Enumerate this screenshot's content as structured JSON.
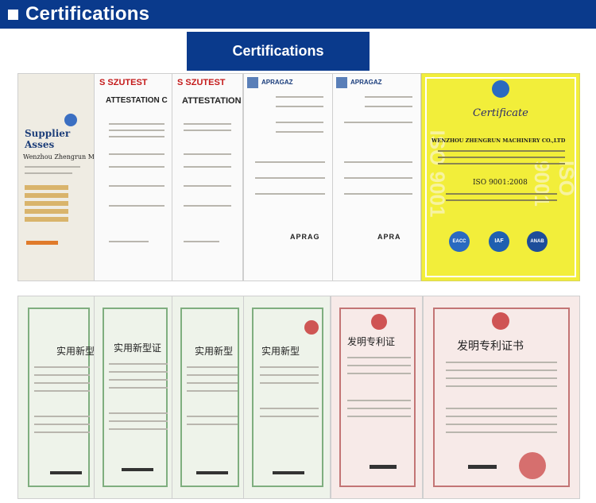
{
  "header": {
    "title": "Certifications"
  },
  "banner": {
    "title": "Certifications"
  },
  "certificates_row1": [
    {
      "name": "supplier-assessment",
      "heading": "Supplier Asses",
      "sub": "Wenzhou Zhengrun M"
    },
    {
      "name": "szutest-1",
      "logo": "SZUTEST",
      "heading": "ATTESTATION C"
    },
    {
      "name": "szutest-2",
      "logo": "SZUTEST",
      "heading": "ATTESTATION"
    },
    {
      "name": "apragaz-1",
      "logo": "APRAGAZ",
      "heading": "APRAG"
    },
    {
      "name": "apragaz-2",
      "logo": "APRAGAZ",
      "heading": "APRA"
    },
    {
      "name": "iso-9001",
      "heading": "Certificate",
      "company": "WENZHOU ZHENGRUN MACHINERY CO.,LTD",
      "standard": "ISO 9001:2008",
      "watermark": "ISO 9001",
      "marks": [
        "EACC",
        "IAF",
        "ANAB"
      ]
    }
  ],
  "certificates_row2": [
    {
      "name": "utility-model-1",
      "heading": "实用新型"
    },
    {
      "name": "utility-model-2",
      "heading": "实用新型证"
    },
    {
      "name": "utility-model-3",
      "heading": "实用新型"
    },
    {
      "name": "utility-model-4",
      "heading": "实用新型"
    },
    {
      "name": "invention-patent-1",
      "heading": "发明专利证"
    },
    {
      "name": "invention-patent-2",
      "heading": "发明专利证书"
    }
  ],
  "colors": {
    "brand_blue": "#0a3a8c",
    "iso_yellow": "#f2ee3a",
    "patent_green": "#7fae7f",
    "patent_red": "#c37575"
  }
}
